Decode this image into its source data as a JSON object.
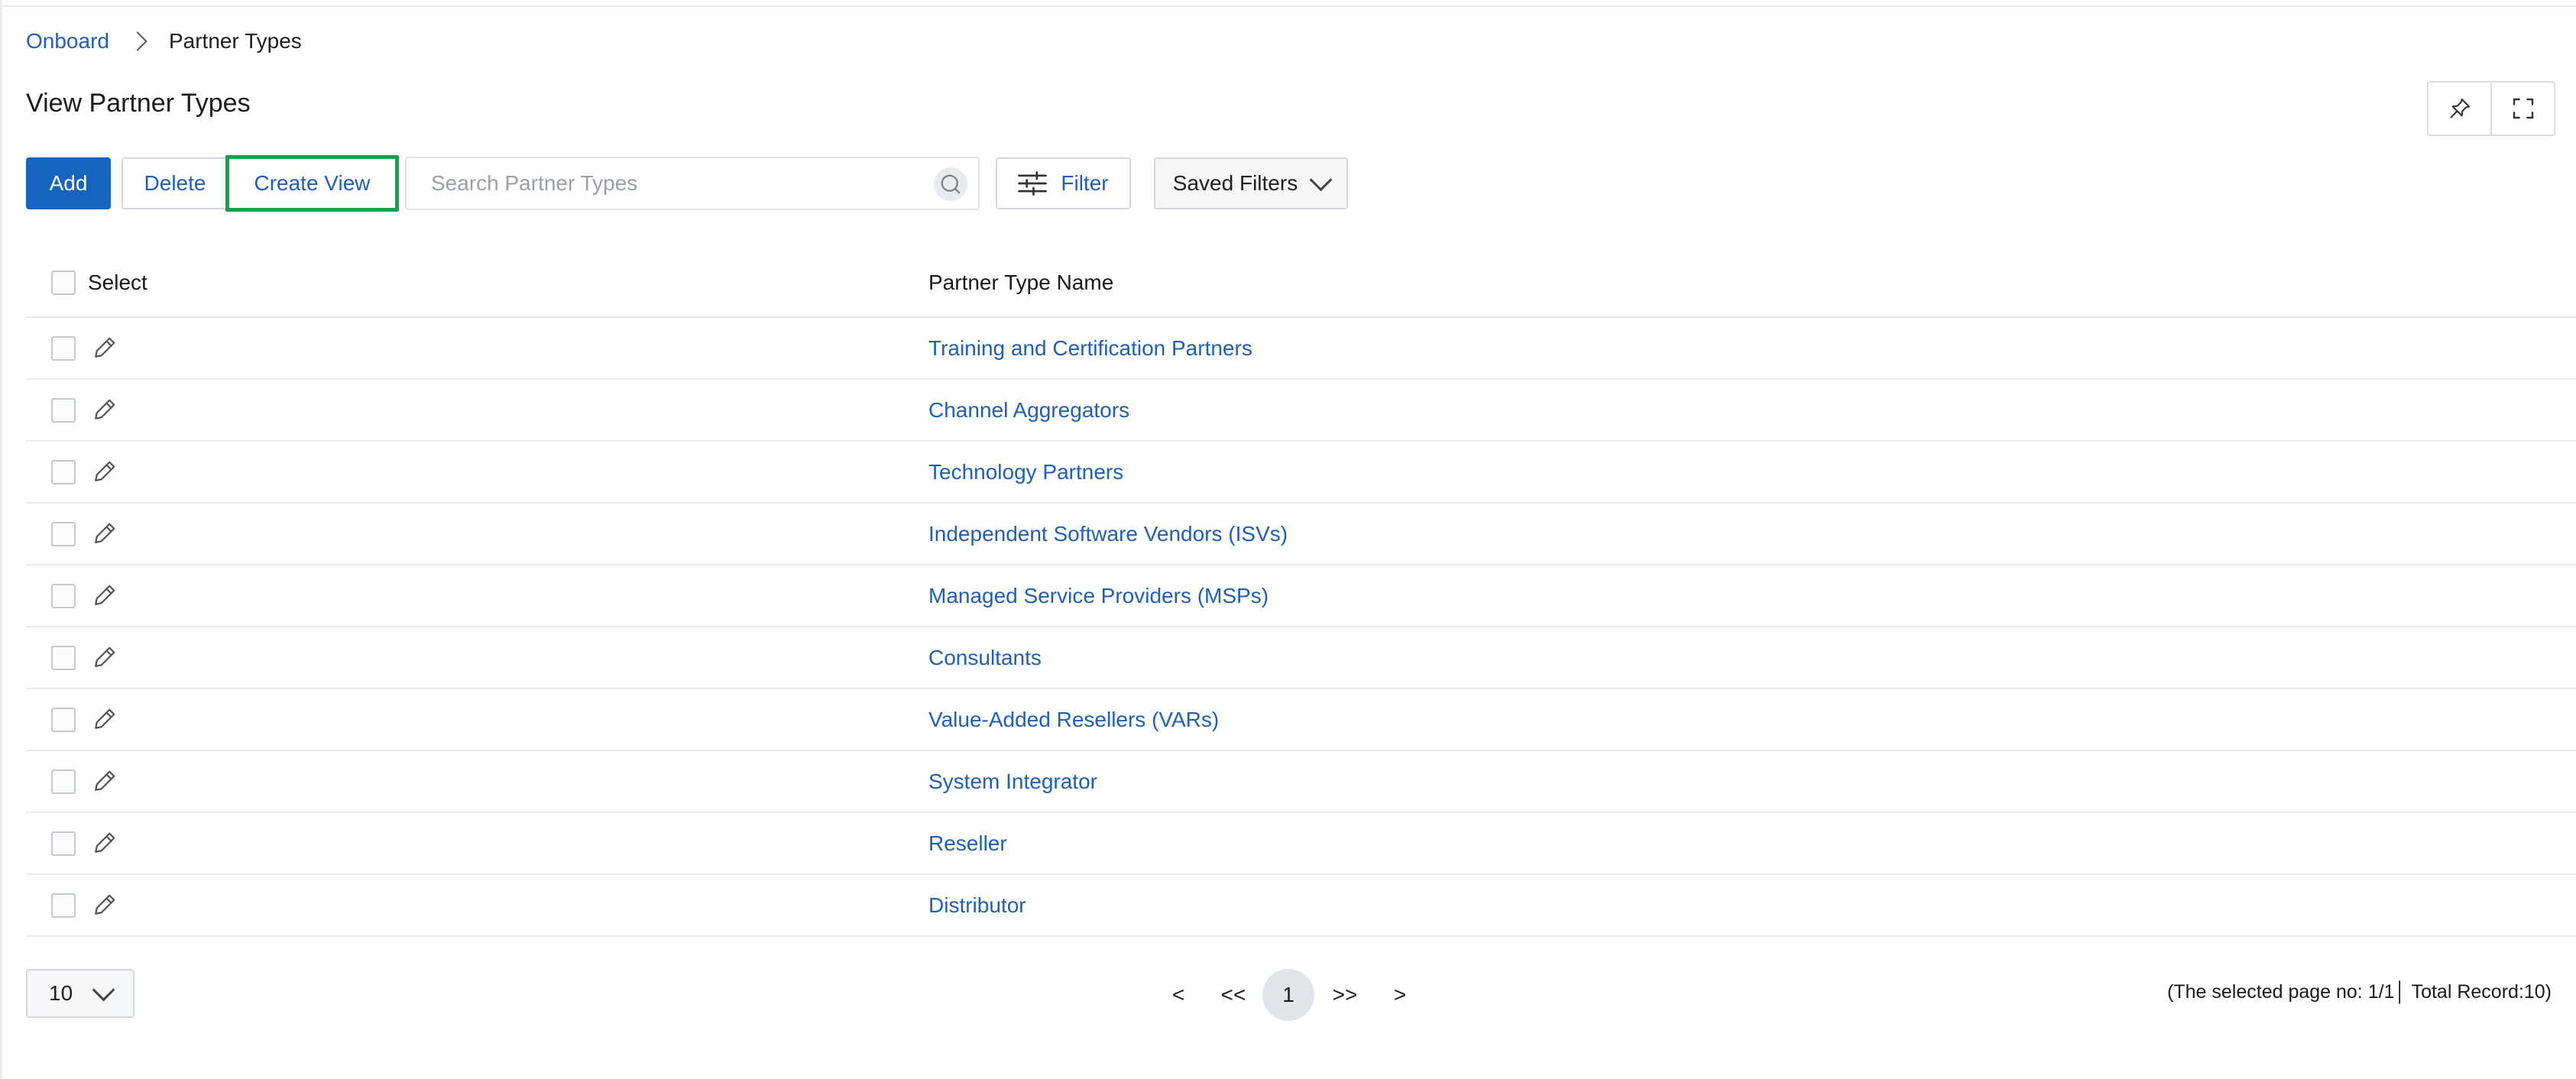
{
  "breadcrumb": {
    "root": "Onboard",
    "current": "Partner Types"
  },
  "page": {
    "title": "View Partner Types"
  },
  "toolbar": {
    "add_label": "Add",
    "delete_label": "Delete",
    "create_view_label": "Create View",
    "search_placeholder": "Search Partner Types",
    "filter_label": "Filter",
    "saved_filters_label": "Saved Filters"
  },
  "table": {
    "columns": {
      "select": "Select",
      "name": "Partner Type Name"
    },
    "rows": [
      "Training and Certification Partners",
      "Channel Aggregators",
      "Technology Partners",
      "Independent Software Vendors (ISVs)",
      "Managed Service Providers (MSPs)",
      "Consultants",
      "Value-Added Resellers (VARs)",
      "System Integrator",
      "Reseller",
      "Distributor"
    ]
  },
  "pagination": {
    "page_size": "10",
    "prev": "<",
    "first": "<<",
    "current": "1",
    "last": ">>",
    "next": ">",
    "summary": "(The selected page no: 1/1│ Total Record:10)"
  },
  "colors": {
    "primary": "#1565c0",
    "link": "#1f5fb8",
    "highlight_border": "#1aa04a"
  },
  "icons": [
    "chevron-right-icon",
    "pin-icon",
    "fullscreen-icon",
    "search-icon",
    "filter-sliders-icon",
    "chevron-down-icon",
    "edit-pencil-icon"
  ]
}
